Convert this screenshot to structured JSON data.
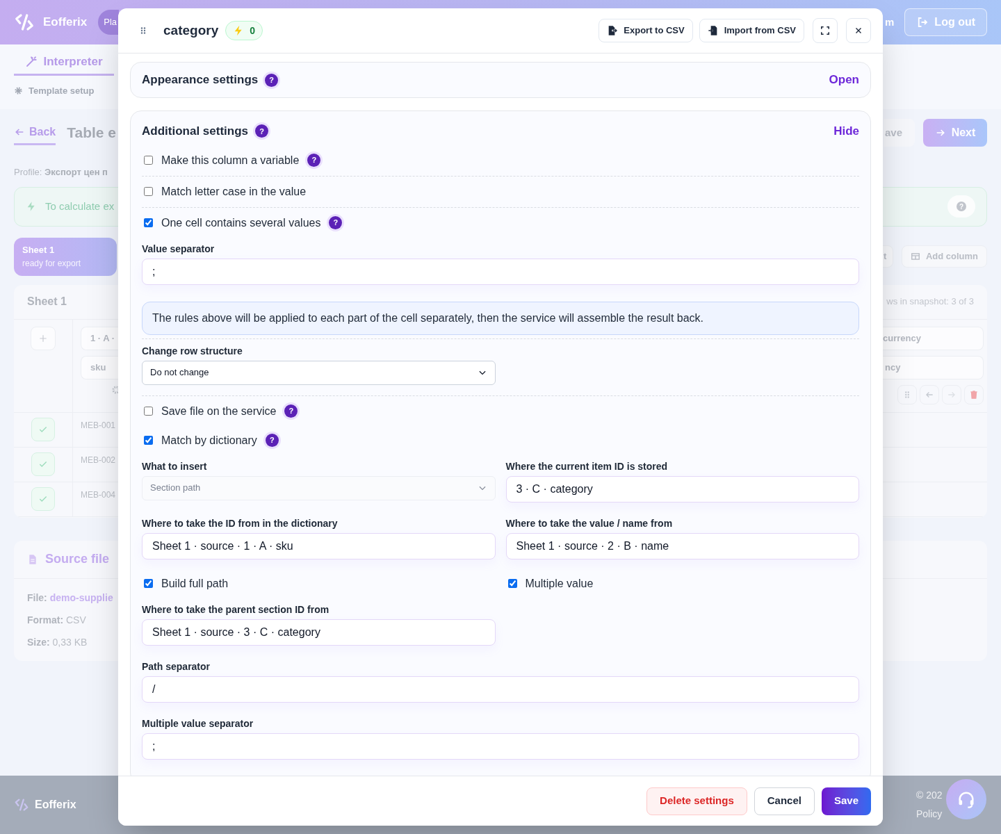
{
  "page": {
    "brand": "Eofferix",
    "plan_cut": "Pla",
    "header_cut": "m",
    "logout": "Log out",
    "tab": "Interpreter",
    "template_setup": "Template setup",
    "back": "Back",
    "title_cut": "Table e",
    "save_cut": "ave",
    "next": "Next",
    "profile_label": "Profile:",
    "profile_value": "Экспорт цен п",
    "hint_cut": "To calculate ex",
    "hint_help": "?",
    "sheet_tab": {
      "name": "Sheet 1",
      "status": "ready for export"
    },
    "toolbar_cut": "t",
    "add_column": "Add column",
    "sheet": {
      "title": "Sheet 1",
      "snapshot": "ws in snapshot: 3 of 3",
      "header_cell": "1 · A ·",
      "name_cell": "sku",
      "right_header": "currency",
      "right_name": "ncy",
      "rows": [
        {
          "sku": "MEB-001",
          "checked": true
        },
        {
          "sku": "MEB-002",
          "checked": true
        },
        {
          "sku": "MEB-004",
          "checked": true
        }
      ]
    },
    "source": {
      "title": "Source file",
      "file_label": "File:",
      "file_value": "demo-supplie",
      "format_label": "Format:",
      "format_value": "CSV",
      "size_label": "Size:",
      "size_value": "0,33 KB"
    },
    "footer": {
      "brand": "Eofferix",
      "copyright": "© 202",
      "policy": "Policy"
    }
  },
  "modal": {
    "title": "category",
    "badge": "0",
    "export": "Export to CSV",
    "import": "Import from CSV",
    "sections": [
      {
        "title": "Appearance settings",
        "help": "?",
        "action": "Open",
        "expanded": false
      },
      {
        "title": "Additional settings",
        "help": "?",
        "action": "Hide",
        "expanded": true
      }
    ],
    "items": [
      {
        "kind": "checkbox",
        "label": "Make this column a variable",
        "checked": false,
        "help": "?"
      },
      {
        "kind": "divider"
      },
      {
        "kind": "checkbox",
        "label": "Match letter case in the value",
        "checked": false
      },
      {
        "kind": "divider"
      },
      {
        "kind": "checkbox",
        "label": "One cell contains several values",
        "checked": true,
        "help": "?"
      },
      {
        "kind": "field",
        "label": "Value separator",
        "value": ";"
      },
      {
        "kind": "note",
        "text": "The rules above will be applied to each part of the cell separately, then the service will assemble the result back."
      },
      {
        "kind": "divider"
      },
      {
        "kind": "pair",
        "left": {
          "kind": "select",
          "label": "Change row structure",
          "value": "Do not change",
          "disabled": false
        }
      },
      {
        "kind": "divider"
      },
      {
        "kind": "checkbox",
        "label": "Save file on the service",
        "checked": false,
        "help": "?"
      },
      {
        "kind": "checkbox",
        "label": "Match by dictionary",
        "checked": true,
        "help": "?"
      },
      {
        "kind": "pair",
        "left": {
          "kind": "select",
          "label": "What to insert",
          "value": "Section path",
          "disabled": true
        },
        "right": {
          "kind": "field",
          "label": "Where the current item ID is stored",
          "value": "3 · C · category"
        }
      },
      {
        "kind": "pair",
        "left": {
          "kind": "field",
          "label": "Where to take the ID from in the dictionary",
          "value": "Sheet 1 · source · 1 · A · sku"
        },
        "right": {
          "kind": "field",
          "label": "Where to take the value / name from",
          "value": "Sheet 1 · source · 2 · B · name"
        }
      },
      {
        "kind": "pair",
        "left": {
          "kind": "checkbox",
          "label": "Build full path",
          "checked": true
        },
        "right": {
          "kind": "checkbox",
          "label": "Multiple value",
          "checked": true
        }
      },
      {
        "kind": "pair",
        "left": {
          "kind": "field",
          "label": "Where to take the parent section ID from",
          "value": "Sheet 1 · source · 3 · C · category"
        }
      },
      {
        "kind": "field",
        "label": "Path separator",
        "value": "/"
      },
      {
        "kind": "field",
        "label": "Multiple value separator",
        "value": ";"
      }
    ],
    "delete": "Delete settings",
    "cancel": "Cancel",
    "save": "Save"
  }
}
